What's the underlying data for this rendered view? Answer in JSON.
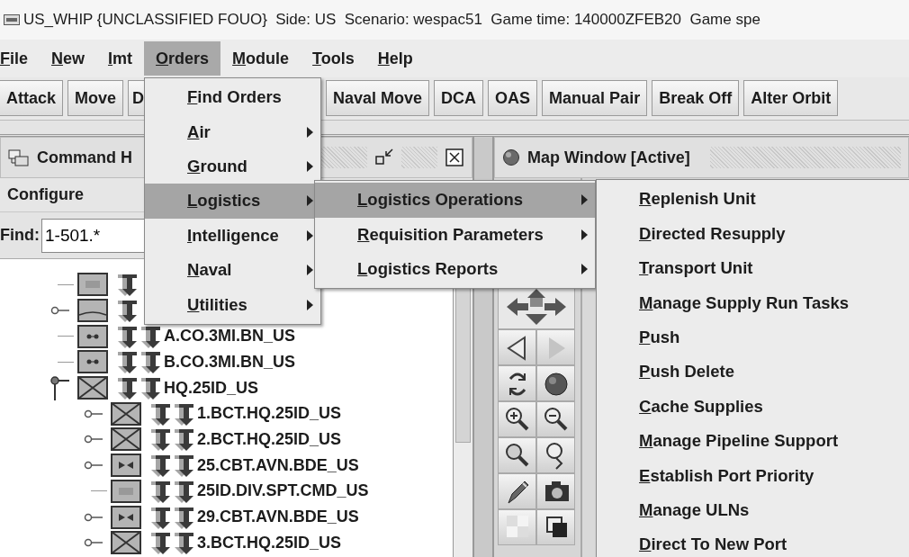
{
  "window": {
    "title": "US_WHIP {UNCLASSIFIED FOUO}  Side: US  Scenario: wespac51  Game time: 140000ZFEB20  Game spe"
  },
  "menu_bar": {
    "mnemonics": true,
    "items": [
      {
        "label": "File",
        "selected": false
      },
      {
        "label": "New",
        "selected": false
      },
      {
        "label": "Imt",
        "selected": false
      },
      {
        "label": "Orders",
        "selected": true
      },
      {
        "label": "Module",
        "selected": false
      },
      {
        "label": "Tools",
        "selected": false
      },
      {
        "label": "Help",
        "selected": false
      }
    ]
  },
  "toolbar": {
    "buttons": [
      {
        "label": "Attack",
        "covered": false
      },
      {
        "label": "Move",
        "covered": false
      },
      {
        "label": "D",
        "covered": true
      },
      {
        "label": "Naval Move",
        "covered": false
      },
      {
        "label": "DCA",
        "covered": false
      },
      {
        "label": "OAS",
        "covered": false
      },
      {
        "label": "Manual Pair",
        "covered": false
      },
      {
        "label": "Break Off",
        "covered": false
      },
      {
        "label": "Alter Orbit",
        "covered": false
      }
    ]
  },
  "command_panel": {
    "title": "Command H",
    "configure": "Configure",
    "find": {
      "label": "Find:",
      "value": "1-501.*"
    },
    "tree": [
      {
        "kind": "support",
        "expandable": false
      },
      {
        "kind": "plain",
        "expandable": true,
        "expanded": false
      },
      {
        "label": "A.CO.3MI.BN_US",
        "kind": "intelligence",
        "expandable": false
      },
      {
        "label": "B.CO.3MI.BN_US",
        "kind": "intelligence",
        "expandable": false
      },
      {
        "label": "HQ.25ID_US",
        "kind": "infantry",
        "expandable": true,
        "expanded": true,
        "children": [
          {
            "label": "1.BCT.HQ.25ID_US",
            "kind": "infantry",
            "expandable": true,
            "expanded": false
          },
          {
            "label": "2.BCT.HQ.25ID_US",
            "kind": "infantry",
            "expandable": true,
            "expanded": false
          },
          {
            "label": "25.CBT.AVN.BDE_US",
            "kind": "aviation",
            "expandable": true,
            "expanded": false
          },
          {
            "label": "25ID.DIV.SPT.CMD_US",
            "kind": "support",
            "expandable": false
          },
          {
            "label": "29.CBT.AVN.BDE_US",
            "kind": "aviation",
            "expandable": true,
            "expanded": false
          },
          {
            "label": "3.BCT.HQ.25ID_US",
            "kind": "infantry",
            "expandable": true,
            "expanded": false
          }
        ]
      }
    ]
  },
  "map_window": {
    "title": "Map Window [Active]",
    "forward_disabled": true
  },
  "menus": [
    {
      "items": [
        {
          "label": "Find Orders",
          "submenu": false,
          "selected": false
        },
        {
          "label": "Air",
          "submenu": true,
          "selected": false
        },
        {
          "label": "Ground",
          "submenu": true,
          "selected": false
        },
        {
          "label": "Logistics",
          "submenu": true,
          "selected": true
        },
        {
          "label": "Intelligence",
          "submenu": true,
          "selected": false
        },
        {
          "label": "Naval",
          "submenu": true,
          "selected": false
        },
        {
          "label": "Utilities",
          "submenu": true,
          "selected": false
        }
      ]
    },
    {
      "items": [
        {
          "label": "Logistics Operations",
          "submenu": true,
          "selected": true
        },
        {
          "label": "Requisition Parameters",
          "submenu": true,
          "selected": false
        },
        {
          "label": "Logistics Reports",
          "submenu": true,
          "selected": false
        }
      ]
    },
    {
      "items": [
        {
          "label": "Replenish Unit",
          "submenu": false,
          "selected": false
        },
        {
          "label": "Directed Resupply",
          "submenu": false,
          "selected": false
        },
        {
          "label": "Transport Unit",
          "submenu": false,
          "selected": false
        },
        {
          "label": "Manage Supply Run Tasks",
          "submenu": false,
          "selected": false
        },
        {
          "label": "Push",
          "submenu": false,
          "selected": false
        },
        {
          "label": "Push Delete",
          "submenu": false,
          "selected": false
        },
        {
          "label": "Cache Supplies",
          "submenu": false,
          "selected": false
        },
        {
          "label": "Manage Pipeline Support",
          "submenu": false,
          "selected": false
        },
        {
          "label": "Establish Port Priority",
          "submenu": false,
          "selected": false
        },
        {
          "label": "Manage ULNs",
          "submenu": false,
          "selected": false
        },
        {
          "label": "Direct To New Port",
          "submenu": false,
          "selected": false
        }
      ]
    }
  ]
}
